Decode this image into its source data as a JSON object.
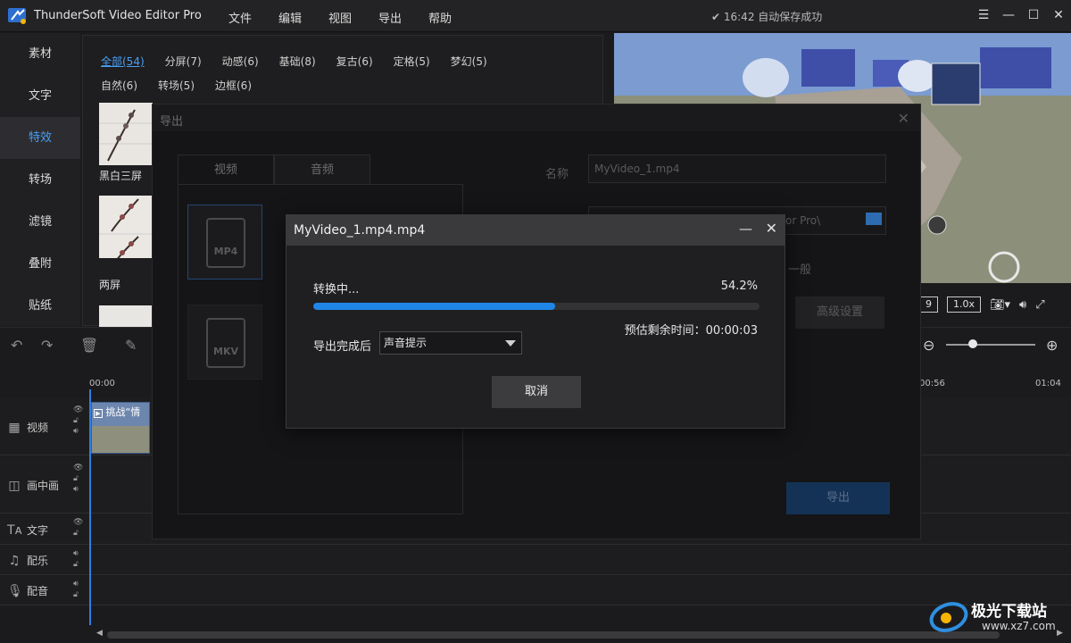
{
  "app": {
    "title": "ThunderSoft Video Editor Pro",
    "menu": [
      "文件",
      "编辑",
      "视图",
      "导出",
      "帮助"
    ],
    "save_status": "✔ 16:42 自动保存成功"
  },
  "leftnav": {
    "items": [
      "素材",
      "文字",
      "特效",
      "转场",
      "滤镜",
      "叠附",
      "贴纸"
    ],
    "active_index": 2
  },
  "library": {
    "categories_row1": [
      "全部(54)",
      "分屏(7)",
      "动感(6)",
      "基础(8)",
      "复古(6)",
      "定格(5)",
      "梦幻(5)"
    ],
    "categories_row2": [
      "自然(6)",
      "转场(5)",
      "边框(6)"
    ],
    "thumb_labels": [
      "黑白三屏",
      "两屏"
    ]
  },
  "preview": {
    "speed": "1.0x",
    "frame_partial": "9"
  },
  "timeline": {
    "ruler": [
      "00:00",
      "00:56",
      "01:04"
    ],
    "tracks": [
      "视频",
      "画中画",
      "文字",
      "配乐",
      "配音"
    ],
    "clip_label": "挑战“情"
  },
  "export_dialog": {
    "title": "导出",
    "tabs": [
      "视频",
      "音频"
    ],
    "formats": [
      "MP4",
      "MKV"
    ],
    "name_label": "名称",
    "name_value": "MyVideo_1.mp4",
    "path_value": "or Pro\\",
    "quality_value": "一般",
    "advanced_label": "高级设置",
    "export_label": "导出"
  },
  "progress_dialog": {
    "title": "MyVideo_1.mp4.mp4",
    "status": "转换中...",
    "percent_text": "54.2%",
    "progress": 0.542,
    "remaining": "预估剩余时间：00:00:03",
    "after_label": "导出完成后",
    "after_value": "声音提示",
    "cancel_label": "取消"
  },
  "watermark": {
    "text": "极光下载站",
    "url": "www.xz7.com"
  },
  "colors": {
    "accent": "#1f86e8",
    "active_text": "#4a9ff5"
  }
}
